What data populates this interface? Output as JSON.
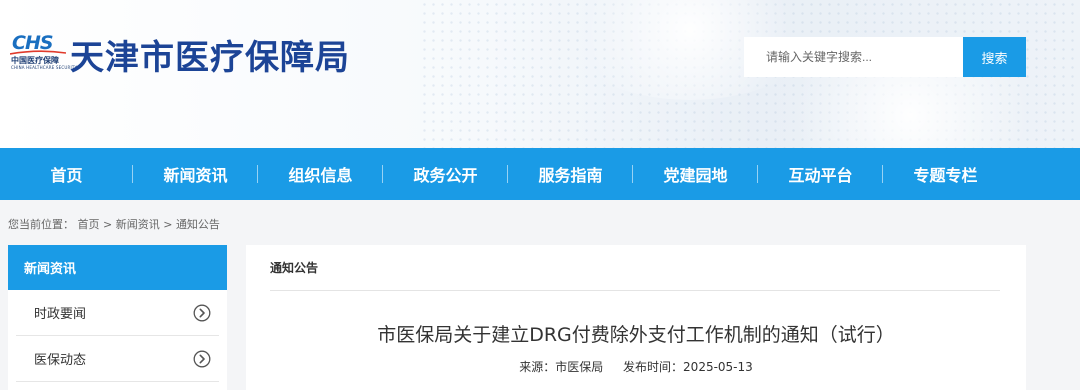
{
  "site": {
    "logo_mark": "CHS",
    "logo_small": "中国医疗保障",
    "logo_tiny": "CHINA HEALTHCARE SECURITY",
    "title": "天津市医疗保障局"
  },
  "search": {
    "placeholder": "请输入关键字搜索...",
    "button_label": "搜索"
  },
  "nav": {
    "items": [
      {
        "label": "首页"
      },
      {
        "label": "新闻资讯"
      },
      {
        "label": "组织信息"
      },
      {
        "label": "政务公开"
      },
      {
        "label": "服务指南"
      },
      {
        "label": "党建园地"
      },
      {
        "label": "互动平台"
      },
      {
        "label": "专题专栏"
      }
    ]
  },
  "breadcrumb": {
    "prefix": "您当前位置：",
    "items": [
      "首页",
      "新闻资讯",
      "通知公告"
    ],
    "separator": ">"
  },
  "sidebar": {
    "heading": "新闻资讯",
    "items": [
      {
        "label": "时政要闻",
        "icon": "circle-chevron-right-icon"
      },
      {
        "label": "医保动态",
        "icon": "circle-chevron-right-icon"
      }
    ]
  },
  "article": {
    "section": "通知公告",
    "title": "市医保局关于建立DRG付费除外支付工作机制的通知（试行）",
    "source_label": "来源：市医保局",
    "date_label": "发布时间：2025-05-13"
  },
  "colors": {
    "primary": "#1a9be6",
    "title_blue": "#1c4496",
    "background": "#f4f5f7"
  }
}
